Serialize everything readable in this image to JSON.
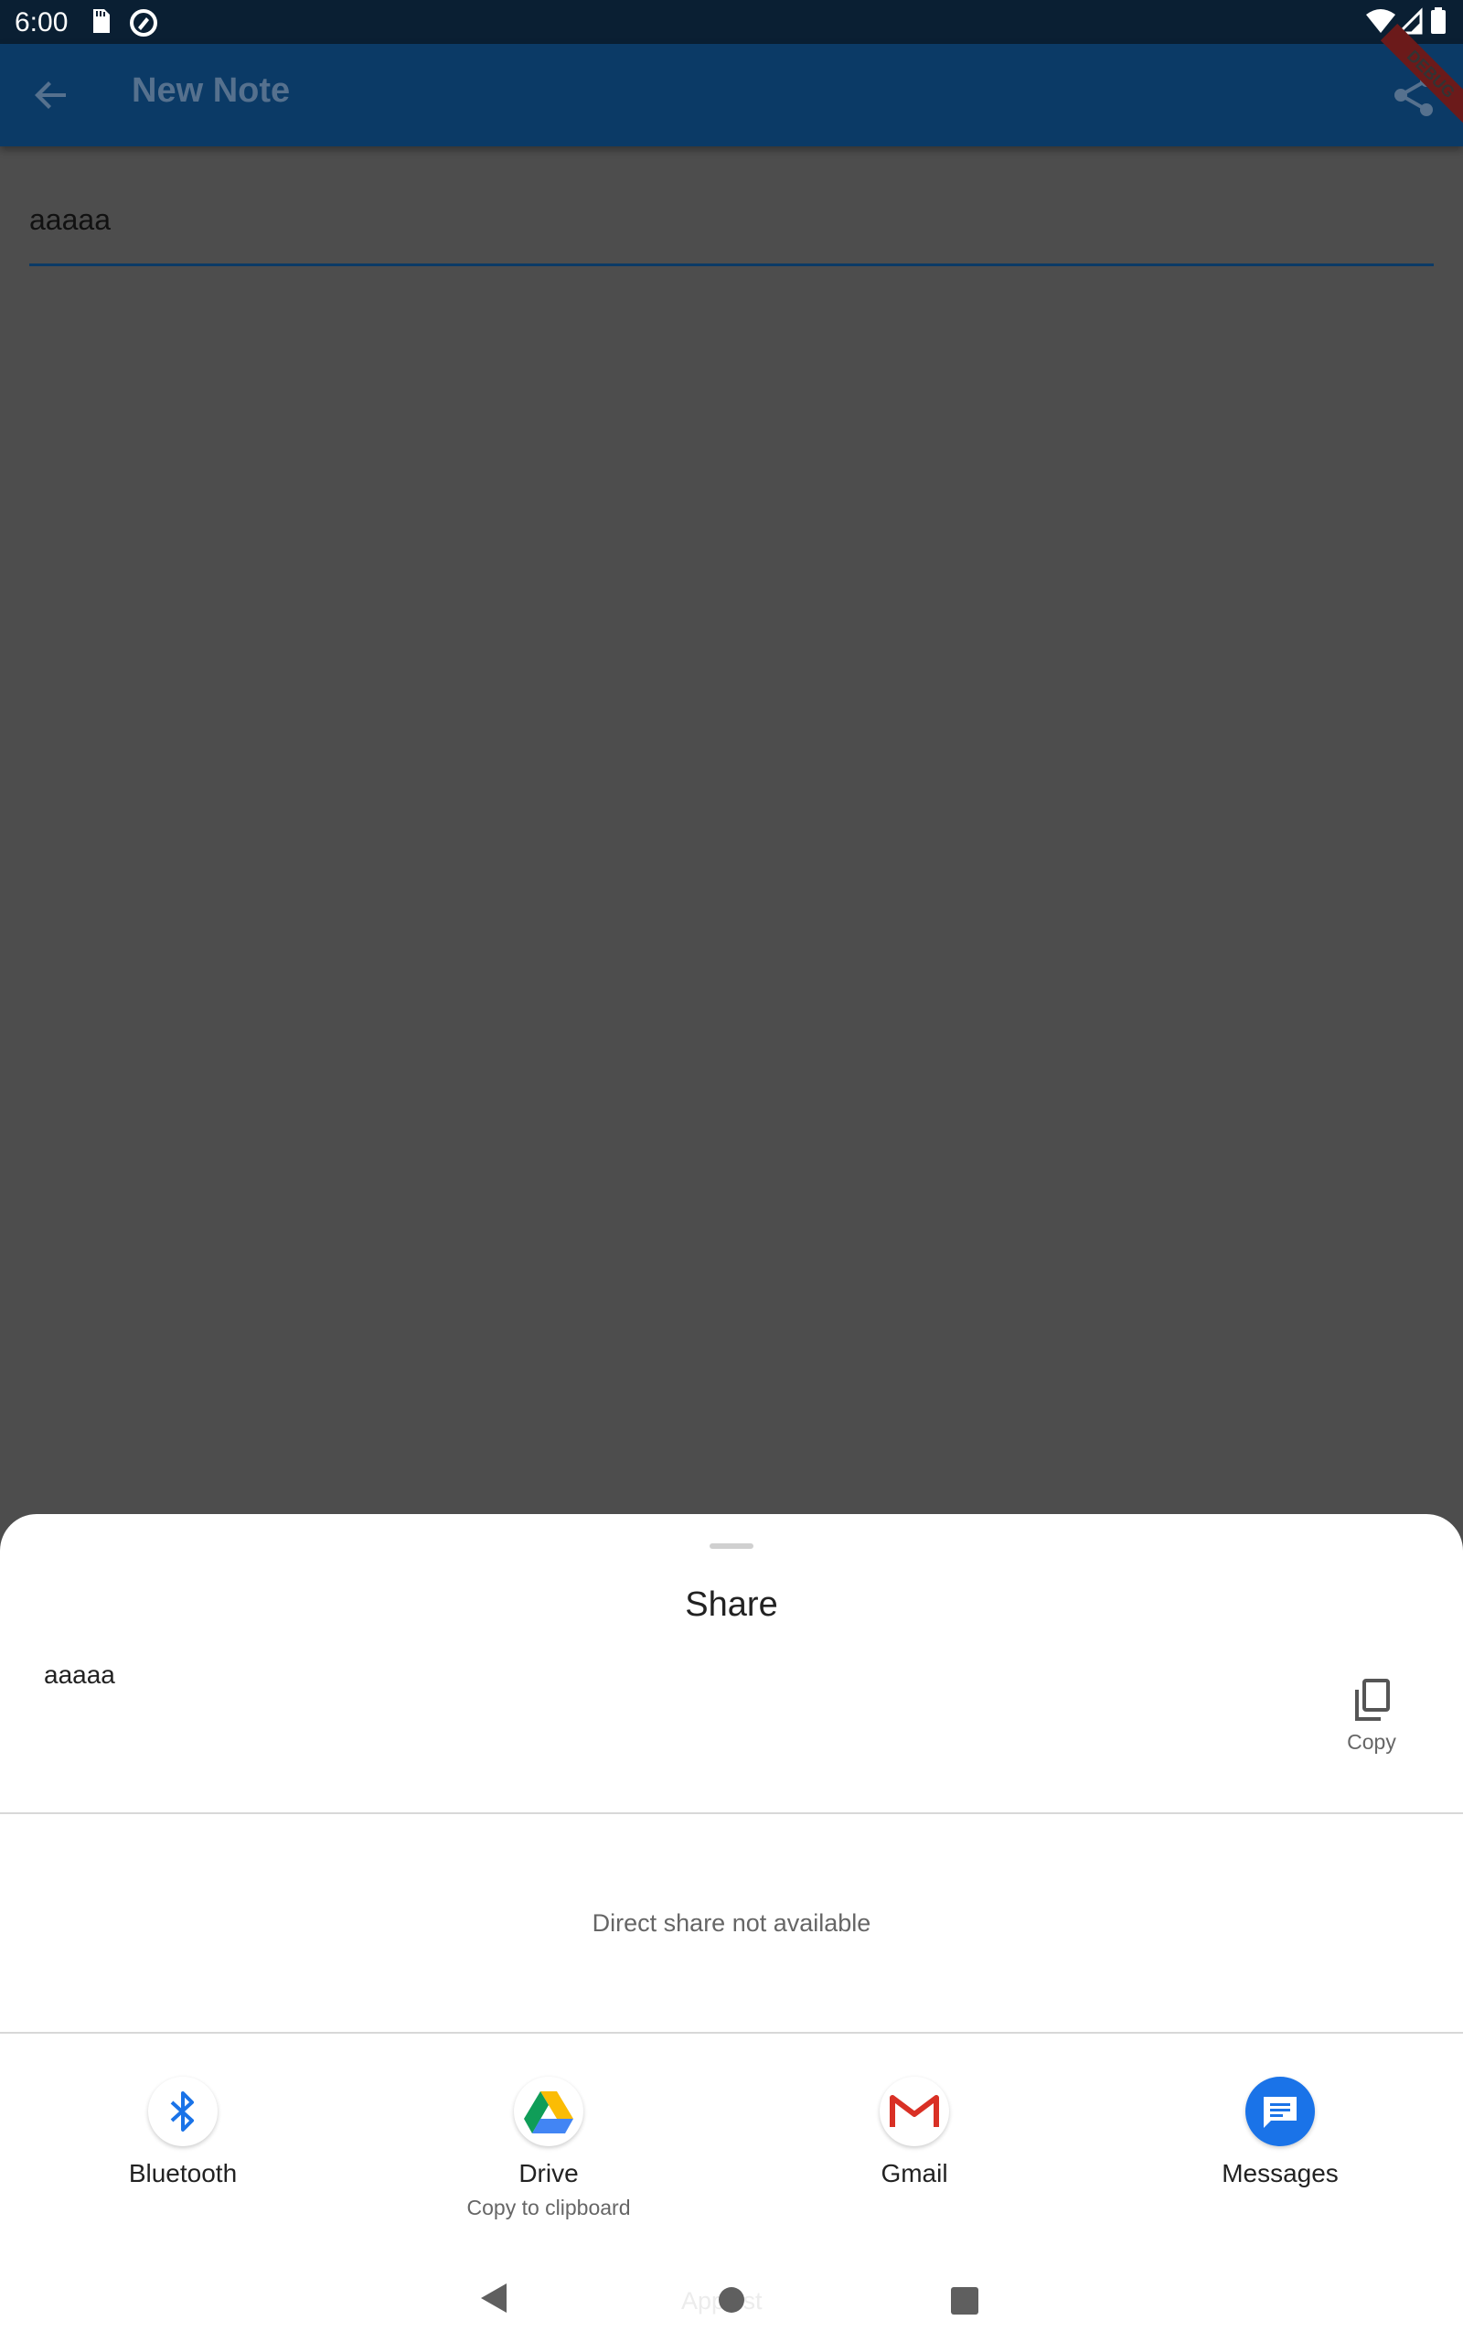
{
  "status_bar": {
    "time": "6:00"
  },
  "app_bar": {
    "title": "New Note",
    "debug_label": "DEBUG"
  },
  "note": {
    "value": "aaaaa"
  },
  "share_sheet": {
    "title": "Share",
    "preview_text": "aaaaa",
    "copy_label": "Copy",
    "direct_share_text": "Direct share not available",
    "apps": [
      {
        "label": "Bluetooth",
        "icon": "bluetooth-icon"
      },
      {
        "label": "Drive",
        "sublabel": "Copy to clipboard",
        "icon": "drive-icon"
      },
      {
        "label": "Gmail",
        "icon": "gmail-icon"
      },
      {
        "label": "Messages",
        "icon": "messages-icon"
      }
    ],
    "ghost_text": "App list"
  },
  "colors": {
    "app_bar": "#0b3a66",
    "scrim": "#4d4d4d",
    "status_bar": "#0a1f33",
    "messages_blue": "#1a73e8"
  }
}
